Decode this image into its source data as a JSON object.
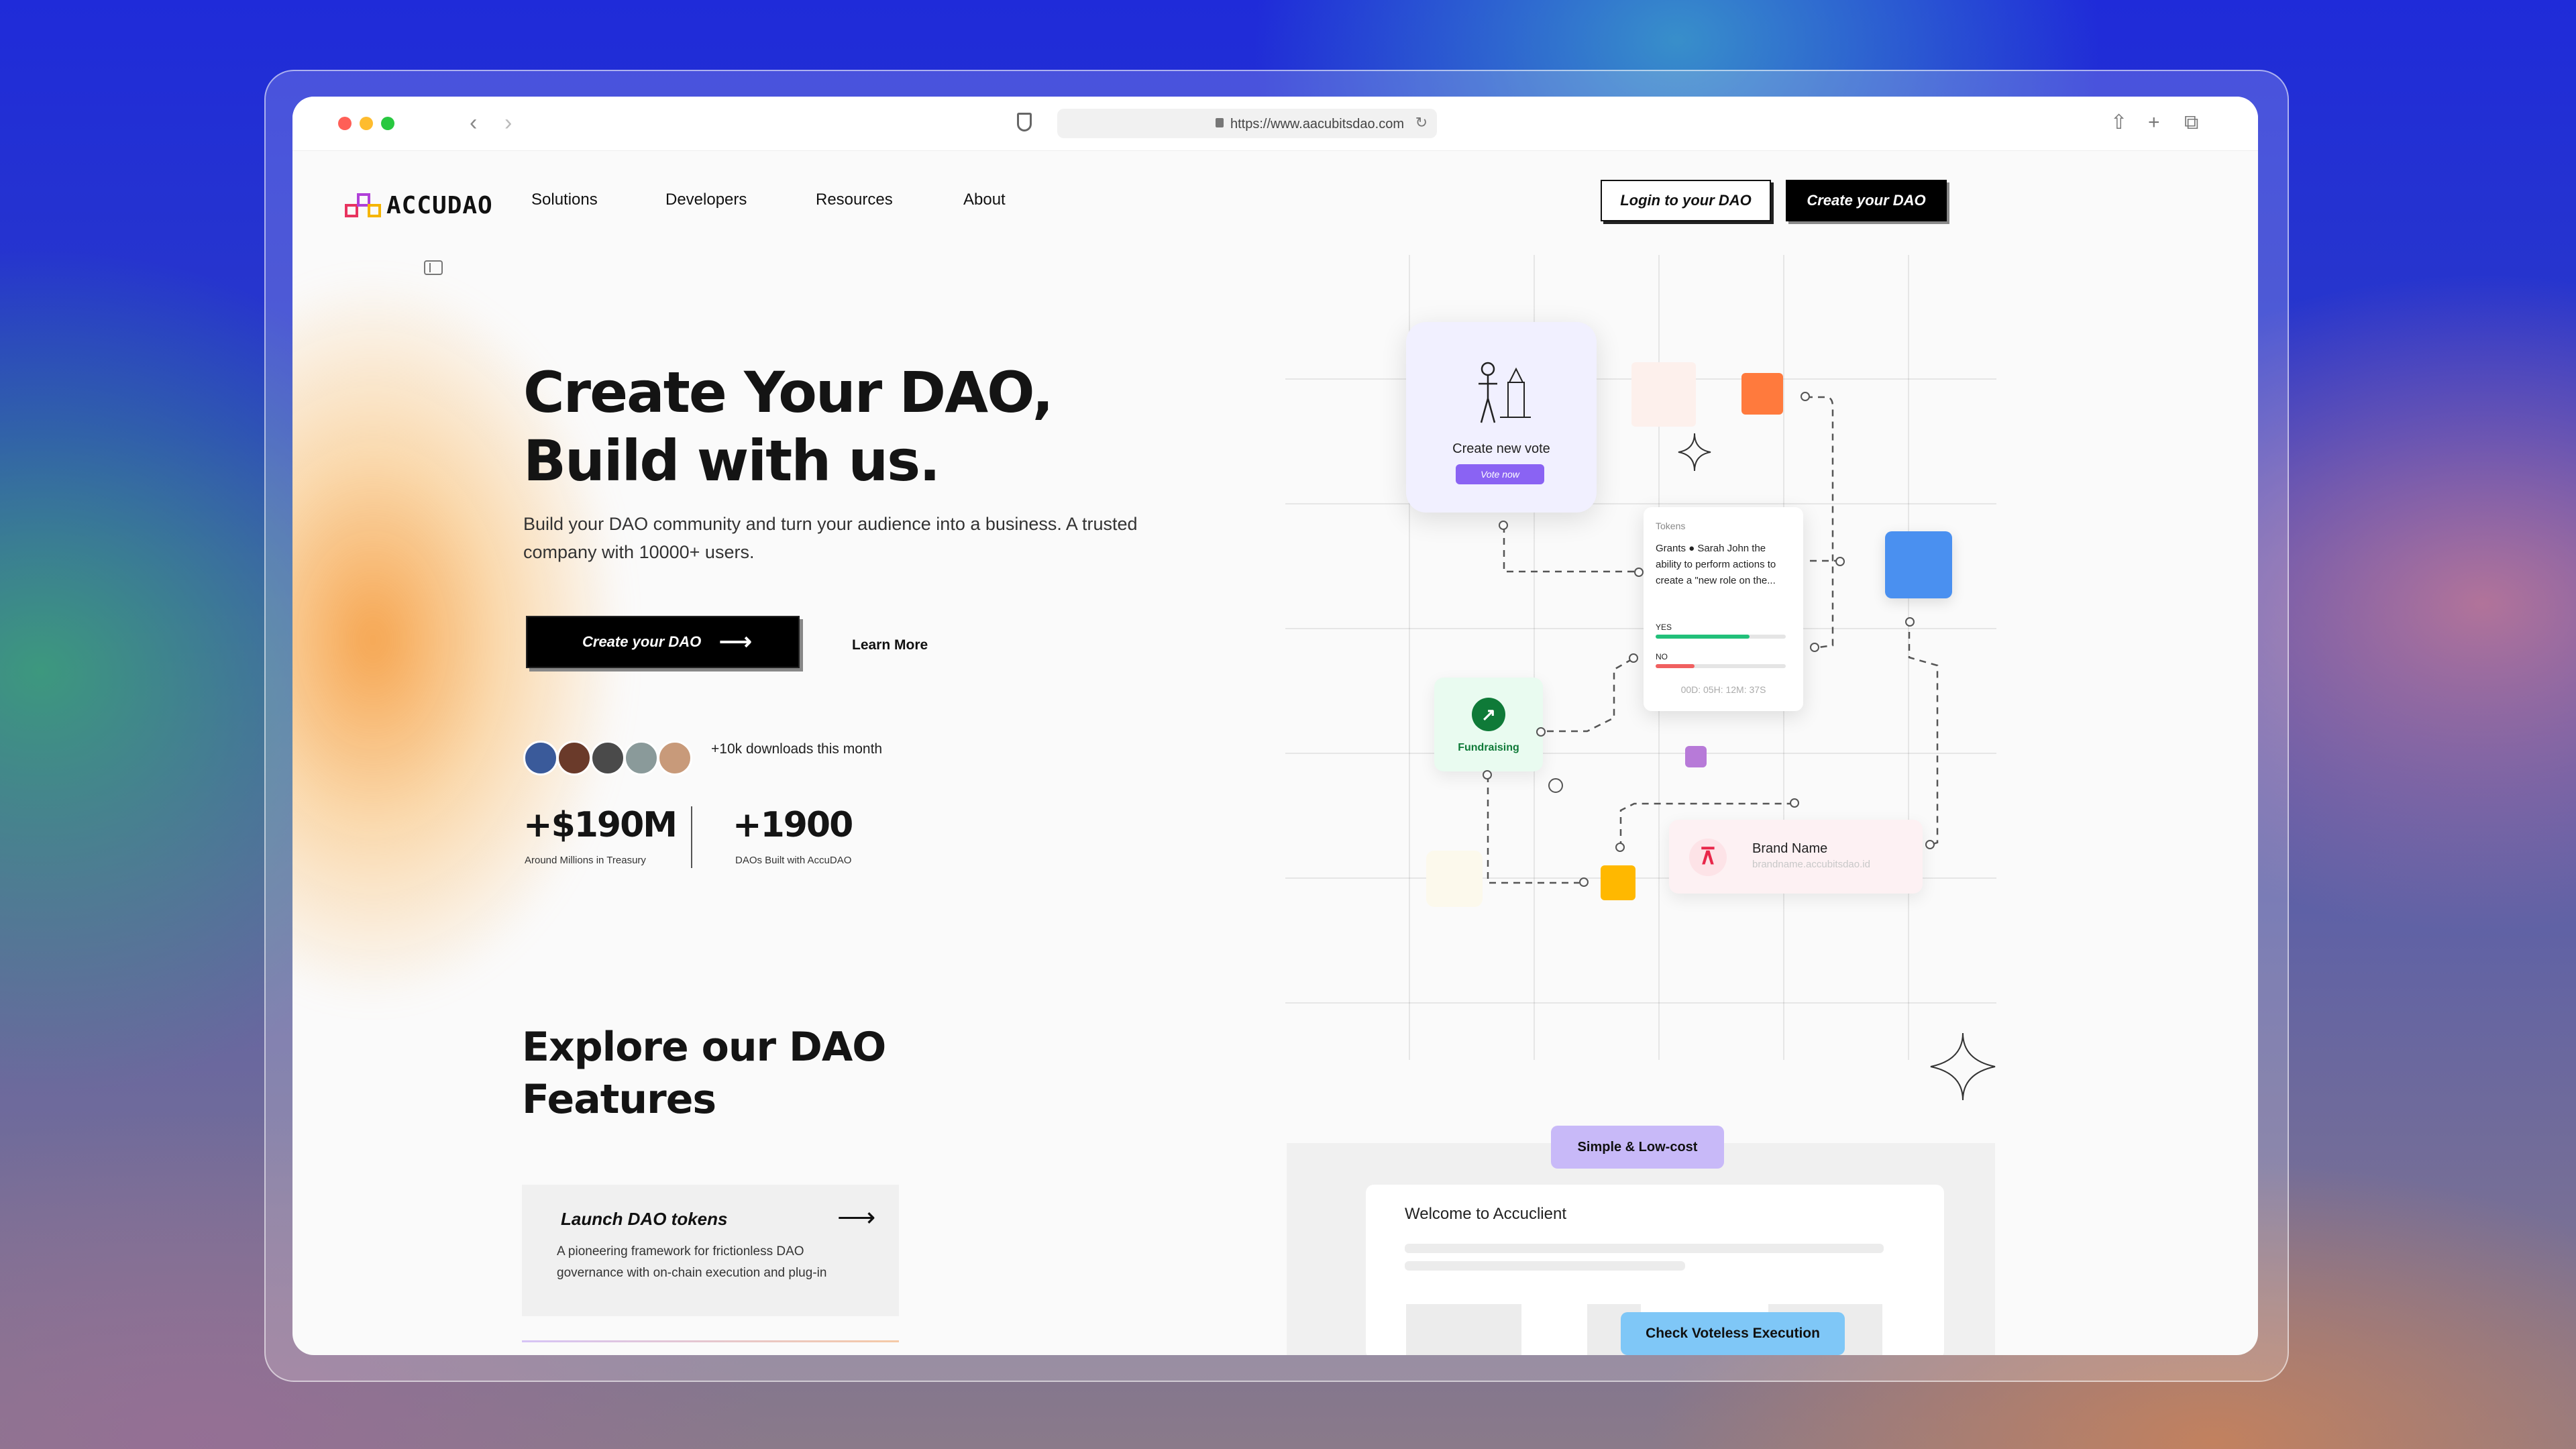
{
  "browser": {
    "url": "https://www.aacubitsdao.com"
  },
  "site": {
    "brand": "ACCUDAO",
    "nav": [
      "Solutions",
      "Developers",
      "Resources",
      "About"
    ],
    "login_label": "Login to your DAO",
    "create_label": "Create your DAO"
  },
  "hero": {
    "title": "Create Your DAO,\nBuild with us.",
    "subtitle": "Build your DAO community and turn your audience into a business. A trusted company with 10000+ users.",
    "cta_label": "Create your DAO",
    "learn_label": "Learn More",
    "downloads_text": "+10k downloads this month",
    "stats": [
      {
        "value": "+$190M",
        "label": "Around Millions in Treasury"
      },
      {
        "value": "+1900",
        "label": "DAOs Built with AccuDAO"
      }
    ]
  },
  "illustration": {
    "vote_title": "Create new vote",
    "vote_button": "Vote now",
    "tokens_label": "Tokens",
    "tokens_desc": "Grants ● Sarah John the ability to perform actions to create a \"new role on the...",
    "yes_label": "YES",
    "no_label": "NO",
    "yes_level": 0.72,
    "no_level": 0.3,
    "timer": "00D: 05H: 12M: 37S",
    "fund_label": "Fundraising",
    "brand_name": "Brand Name",
    "brand_url": "brandname.accubitsdao.id"
  },
  "features": {
    "title": "Explore our  DAO\nFeatures",
    "card_title": "Launch DAO tokens",
    "card_desc": "A pioneering framework for frictionless DAO governance with on-chain execution and plug-in",
    "pill_simple": "Simple & Low-cost",
    "welcome": "Welcome to Accuclient",
    "pill_check": "Check Voteless Execution"
  },
  "colors": {
    "vote_btn": "#8a63f3",
    "orange_square": "#ff7a3d",
    "blue_square": "#4a90f0",
    "purple_square": "#b77ad8",
    "yellow_square": "#ffb800",
    "yes_bar": "#22c07a",
    "no_bar": "#f06060"
  }
}
